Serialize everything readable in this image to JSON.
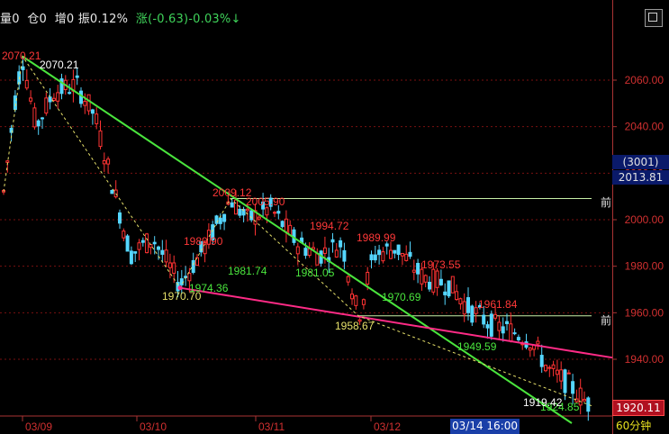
{
  "header": {
    "vol_label": "量0",
    "pos_label": "仓0",
    "inc_label": "增0",
    "amp_label": "振0.12%",
    "chg_label": "涨(-0.63)-0.03%↓"
  },
  "side": {
    "code_label": "(3001)",
    "last_price": "2013.81",
    "current_price": "1920.11",
    "prev_label_1": "前",
    "prev_label_2": "前",
    "timeframe": "60分钟"
  },
  "chart_data": {
    "type": "candlestick",
    "x_ticks": [
      "03/09",
      "03/10",
      "03/11",
      "03/12",
      "03/14 16:00"
    ],
    "y_ticks": [
      2060.0,
      2040.0,
      2020.0,
      2000.0,
      1980.0,
      1960.0,
      1940.0
    ],
    "ylim": [
      1915,
      2076
    ],
    "annotations_red": [
      "2070.21",
      "1989.90",
      "2009.12",
      "2005.90",
      "1994.72",
      "1989.99",
      "1973.55",
      "1961.84"
    ],
    "annotations_green": [
      "1974.36",
      "1981.74",
      "1981.05",
      "1970.69",
      "1949.59",
      "1924.85"
    ],
    "annotations_yellow": [
      "1970.70",
      "1958.67"
    ],
    "annotations_white": [
      "2070.21",
      "1919.42"
    ],
    "horizontal_lines": [
      2009.12,
      1958.67
    ],
    "colors": {
      "up": "#ff3333",
      "down": "#54d6ff",
      "trend_green": "#4ae53d",
      "trend_pink": "#ff2b86",
      "hline": "#c8f0a8"
    }
  }
}
